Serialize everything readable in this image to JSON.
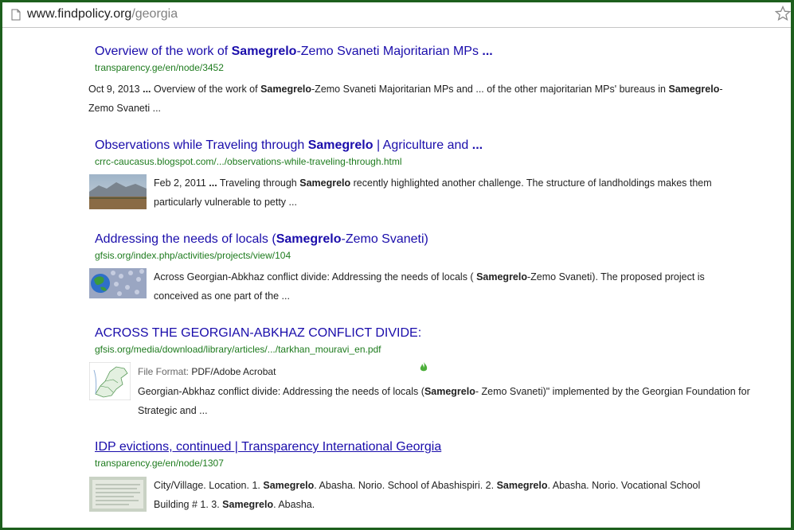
{
  "browser": {
    "url_domain": "www.findpolicy.org",
    "url_path": "/georgia"
  },
  "results": [
    {
      "title_pre": "Overview of the work of ",
      "title_bold": "Samegrelo",
      "title_post": "-Zemo Svaneti Majoritarian MPs ",
      "title_ellipsis": "...",
      "cite": "transparency.ge/en/node/3452",
      "snippet_lines": [
        [
          "Oct 9, 2013 ",
          "b:...",
          " Overview of the work of ",
          "b:Samegrelo",
          "-Zemo Svaneti Majoritarian MPs and ... of the other majoritarian MPs' bureaus in ",
          "b:Samegrelo",
          "-"
        ],
        [
          "Zemo Svaneti ..."
        ]
      ]
    },
    {
      "title_pre": "Observations while Traveling through ",
      "title_bold": "Samegrelo",
      "title_post": " | Agriculture and ",
      "title_ellipsis": "...",
      "cite": "crrc-caucasus.blogspot.com/.../observations-while-traveling-through.html",
      "snippet_lines": [
        [
          "Feb 2, 2011 ",
          "b:...",
          " Traveling through ",
          "b:Samegrelo",
          " recently highlighted another challenge. The structure of landholdings makes them"
        ],
        [
          "particularly vulnerable to petty ..."
        ]
      ]
    },
    {
      "title_pre": "Addressing the needs of locals (",
      "title_bold": "Samegrelo",
      "title_post": "-Zemo Svaneti)",
      "title_ellipsis": "",
      "cite": "gfsis.org/index.php/activities/projects/view/104",
      "snippet_lines": [
        [
          "Across Georgian-Abkhaz conflict divide: Addressing the needs of locals ( ",
          "b:Samegrelo",
          "-Zemo Svaneti). The proposed project is"
        ],
        [
          "conceived as one part of the  ..."
        ]
      ]
    },
    {
      "title_pre": "ACROSS THE GEORGIAN-ABKHAZ CONFLICT DIVIDE:",
      "title_bold": "",
      "title_post": "",
      "title_ellipsis": "",
      "cite": "gfsis.org/media/download/library/articles/.../tarkhan_mouravi_en.pdf",
      "file_format_label": "File Format: ",
      "file_format_value": "PDF/Adobe Acrobat",
      "snippet_lines": [
        [
          "Georgian-Abkhaz conflict divide: Addressing the needs of locals (",
          "b:Samegrelo",
          "- Zemo Svaneti)\" implemented by the Georgian Foundation for"
        ],
        [
          "Strategic and ..."
        ]
      ]
    },
    {
      "title_pre": "IDP evictions, continued | Transparency International Georgia",
      "title_bold": "",
      "title_post": "",
      "title_ellipsis": "",
      "cite": "transparency.ge/en/node/1307",
      "snippet_lines": [
        [
          "City/Village. Location. 1. ",
          "b:Samegrelo",
          ". Abasha. Norio. School of Abashispiri. 2. ",
          "b:Samegrelo",
          ". Abasha. Norio. Vocational School"
        ],
        [
          "Building # 1. 3. ",
          "b:Samegrelo",
          ". Abasha."
        ]
      ]
    }
  ],
  "colors": {
    "link": "#1a0dab",
    "cite": "#1e7b1e",
    "frame": "#1d5f1d"
  }
}
